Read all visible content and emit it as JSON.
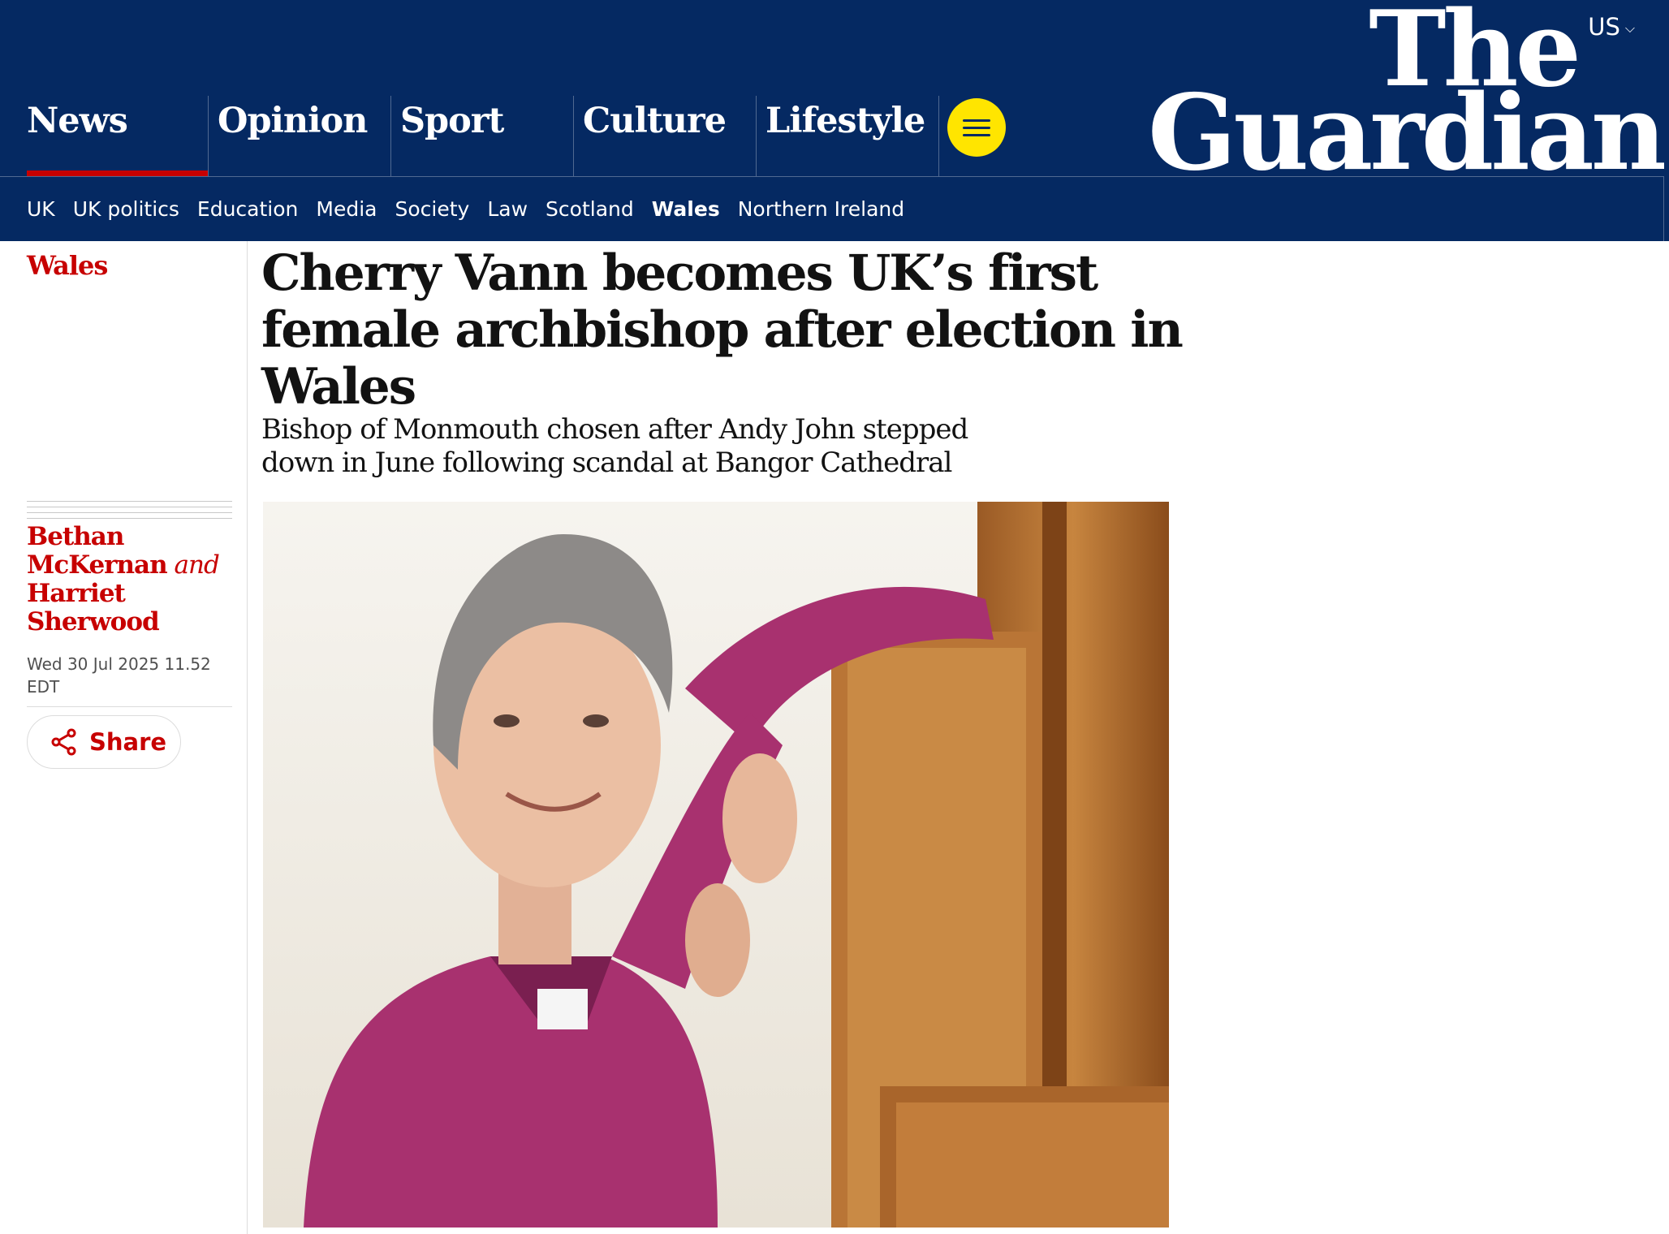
{
  "header": {
    "edition": "US",
    "logo": {
      "line1": "The",
      "line2": "Guardian"
    },
    "pillars": [
      {
        "label": "News",
        "active": true
      },
      {
        "label": "Opinion",
        "active": false
      },
      {
        "label": "Sport",
        "active": false
      },
      {
        "label": "Culture",
        "active": false
      },
      {
        "label": "Lifestyle",
        "active": false
      }
    ],
    "subnav": [
      "UK",
      "UK politics",
      "Education",
      "Media",
      "Society",
      "Law",
      "Scotland",
      "Wales",
      "Northern Ireland"
    ],
    "subnav_current": "Wales"
  },
  "article": {
    "section": "Wales",
    "headline": "Cherry Vann becomes UK’s first female archbishop after election in Wales",
    "standfirst": "Bishop of Monmouth chosen after Andy John stepped down in June following scandal at Bangor Cathedral",
    "byline": {
      "author1": "Bethan McKernan",
      "conjunction": "and",
      "author2": "Harriet Sherwood"
    },
    "dateline": "Wed 30 Jul 2025 11.52 EDT",
    "share_label": "Share"
  },
  "colors": {
    "brand_navy": "#052962",
    "news_red": "#c70000",
    "menu_yellow": "#ffe500"
  },
  "icons": [
    "chevron-down-icon",
    "menu-icon",
    "share-icon"
  ]
}
